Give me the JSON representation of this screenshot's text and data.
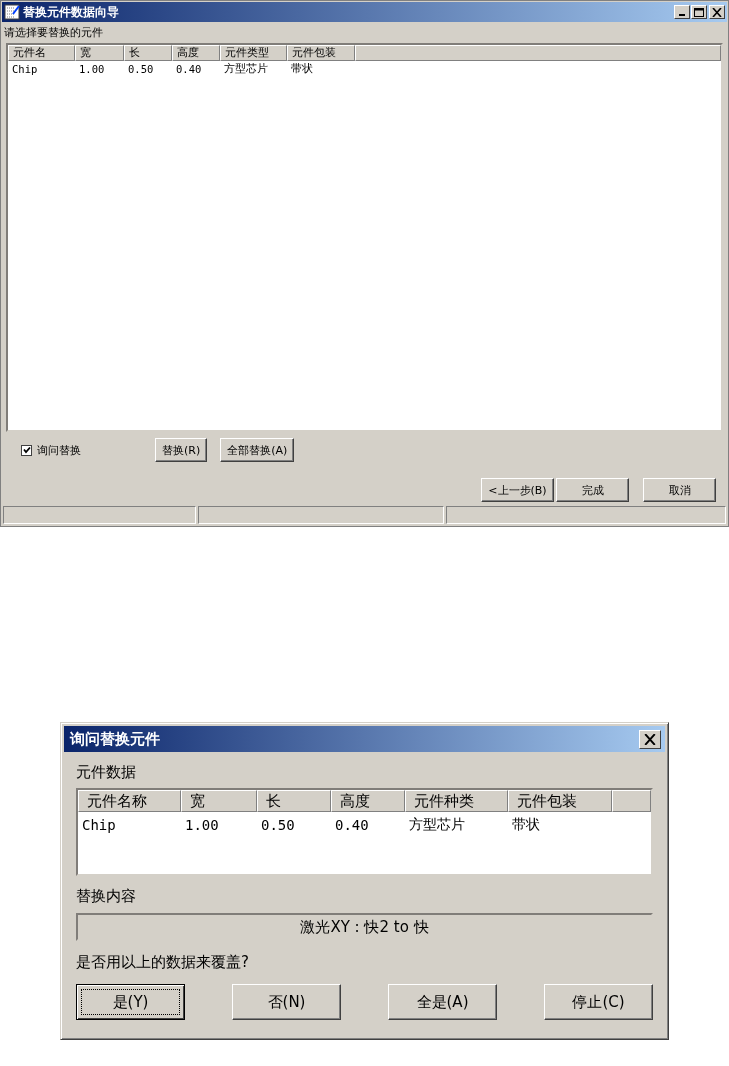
{
  "main_window": {
    "title": "替换元件数据向导",
    "prompt": "请选择要替换的元件",
    "table": {
      "columns": [
        "元件名",
        "宽",
        "长",
        "高度",
        "元件类型",
        "元件包装"
      ],
      "rows": [
        [
          "Chip",
          "1.00",
          "0.50",
          "0.40",
          "方型芯片",
          "带状"
        ]
      ]
    },
    "ask_checkbox": {
      "label": "询问替换",
      "checked": true
    },
    "action_buttons": [
      "替换(R)",
      "全部替换(A)"
    ],
    "nav_buttons": [
      "<上一步(B)",
      "完成",
      "取消"
    ]
  },
  "dialog": {
    "title": "询问替换元件",
    "data_label": "元件数据",
    "table": {
      "columns": [
        "元件名称",
        "宽",
        "长",
        "高度",
        "元件种类",
        "元件包装"
      ],
      "rows": [
        [
          "Chip",
          "1.00",
          "0.50",
          "0.40",
          "方型芯片",
          "带状"
        ]
      ]
    },
    "content_label": "替换内容",
    "content_value": "激光XY : 快2 to 快",
    "question": "是否用以上的数据来覆盖?",
    "buttons": [
      {
        "label": "是(Y)",
        "focused": true
      },
      {
        "label": "否(N)",
        "focused": false
      },
      {
        "label": "全是(A)",
        "focused": false
      },
      {
        "label": "停止(C)",
        "focused": false
      }
    ]
  }
}
